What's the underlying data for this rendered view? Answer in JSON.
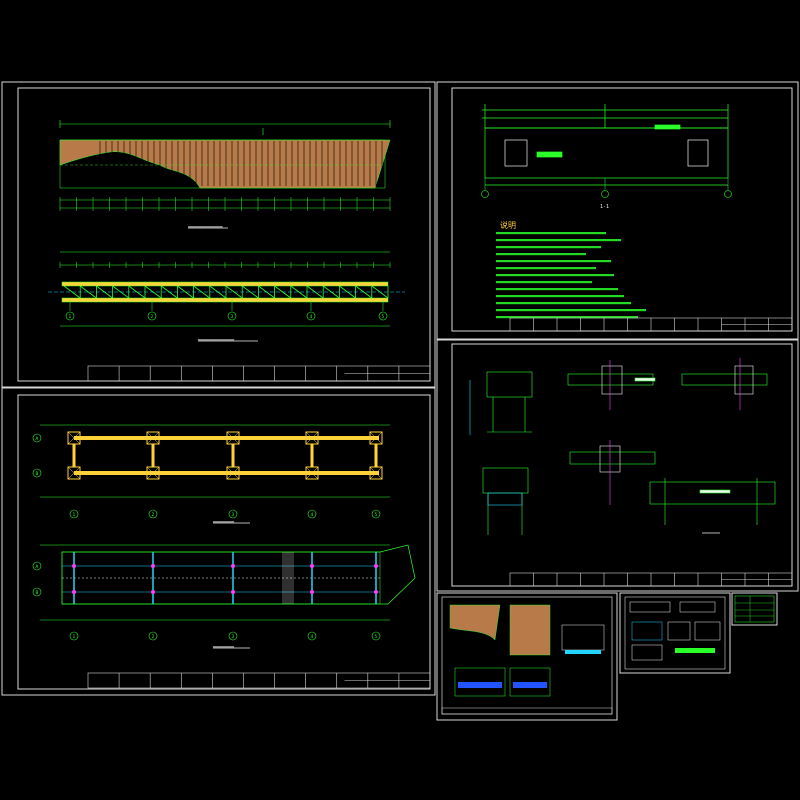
{
  "drawing": {
    "background": "#000000",
    "colors": {
      "frame": "#d8d8d8",
      "green": "#2aff2a",
      "cyan": "#22d6ff",
      "yellow": "#ffd23a",
      "brown": "#b87a48",
      "magenta": "#ff3cff",
      "white": "#f2f2f2"
    },
    "sheets": [
      {
        "id": "sheet-elevation",
        "sheet_no": "结施-01",
        "title_block_label": ""
      },
      {
        "id": "sheet-plan",
        "sheet_no": "结施-02",
        "title_block_label": ""
      },
      {
        "id": "sheet-notes",
        "sheet_no": "结施-03",
        "title_block_label": ""
      },
      {
        "id": "sheet-details",
        "sheet_no": "结施-04",
        "title_block_label": ""
      },
      {
        "id": "sheet-mini-a",
        "sheet_no": "",
        "title_block_label": ""
      },
      {
        "id": "sheet-mini-b",
        "sheet_no": "",
        "title_block_label": ""
      },
      {
        "id": "sheet-mini-c",
        "sheet_no": "",
        "title_block_label": ""
      }
    ],
    "notes_heading": "说明",
    "section_label_a": "1-1",
    "section_label_b": "2-2",
    "axis_bubbles_bottom": [
      "1",
      "2",
      "3",
      "4",
      "5"
    ],
    "axis_bubbles_side": [
      "A",
      "B"
    ]
  }
}
